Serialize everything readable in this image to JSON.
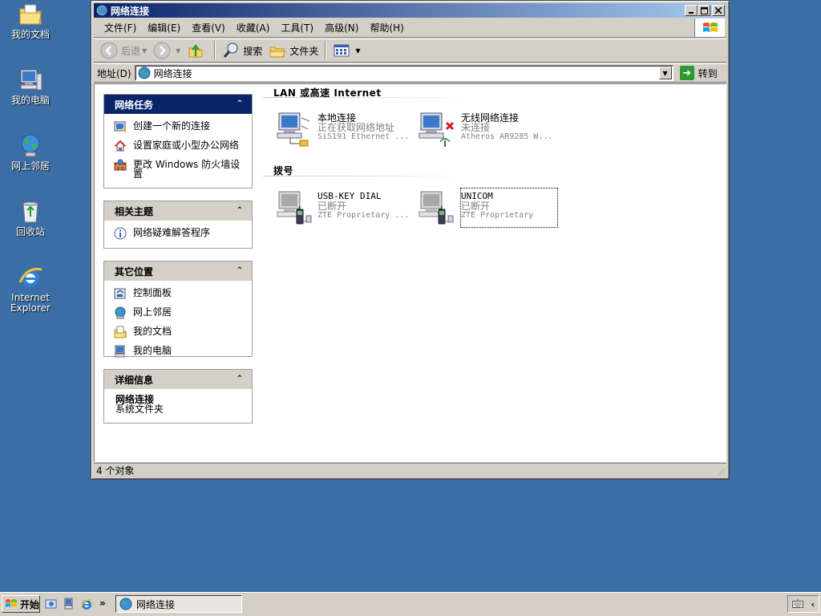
{
  "desktop": {
    "icons": [
      {
        "label": "我的文档"
      },
      {
        "label": "我的电脑"
      },
      {
        "label": "网上邻居"
      },
      {
        "label": "回收站"
      },
      {
        "label": "Internet Explorer"
      }
    ]
  },
  "window": {
    "title": "网络连接",
    "menu": [
      "文件(F)",
      "编辑(E)",
      "查看(V)",
      "收藏(A)",
      "工具(T)",
      "高级(N)",
      "帮助(H)"
    ],
    "toolbar": {
      "back": "后退",
      "search": "搜索",
      "folders": "文件夹"
    },
    "address": {
      "label": "地址(D)",
      "value": "网络连接",
      "go": "转到"
    },
    "status": "4 个对象"
  },
  "panes": {
    "tasks": {
      "title": "网络任务",
      "links": [
        "创建一个新的连接",
        "设置家庭或小型办公网络",
        "更改 Windows 防火墙设置"
      ]
    },
    "related": {
      "title": "相关主题",
      "links": [
        "网络疑难解答程序"
      ]
    },
    "other": {
      "title": "其它位置",
      "links": [
        "控制面板",
        "网上邻居",
        "我的文档",
        "我的电脑"
      ]
    },
    "details": {
      "title": "详细信息",
      "name": "网络连接",
      "type": "系统文件夹"
    }
  },
  "groups": [
    {
      "title": "LAN 或高速 Internet",
      "items": [
        {
          "name": "本地连接",
          "status": "正在获取网络地址",
          "device": "SiS191 Ethernet ..."
        },
        {
          "name": "无线网络连接",
          "status": "未连接",
          "device": "Atheros AR9285 W..."
        }
      ]
    },
    {
      "title": "拨号",
      "items": [
        {
          "name": "USB-KEY DIAL",
          "status": "已断开",
          "device": "ZTE Proprietary ..."
        },
        {
          "name": "UNICOM",
          "status": "已断开",
          "device": "ZTE Proprietary"
        }
      ]
    }
  ],
  "taskbar": {
    "start": "开始",
    "task": "网络连接"
  }
}
